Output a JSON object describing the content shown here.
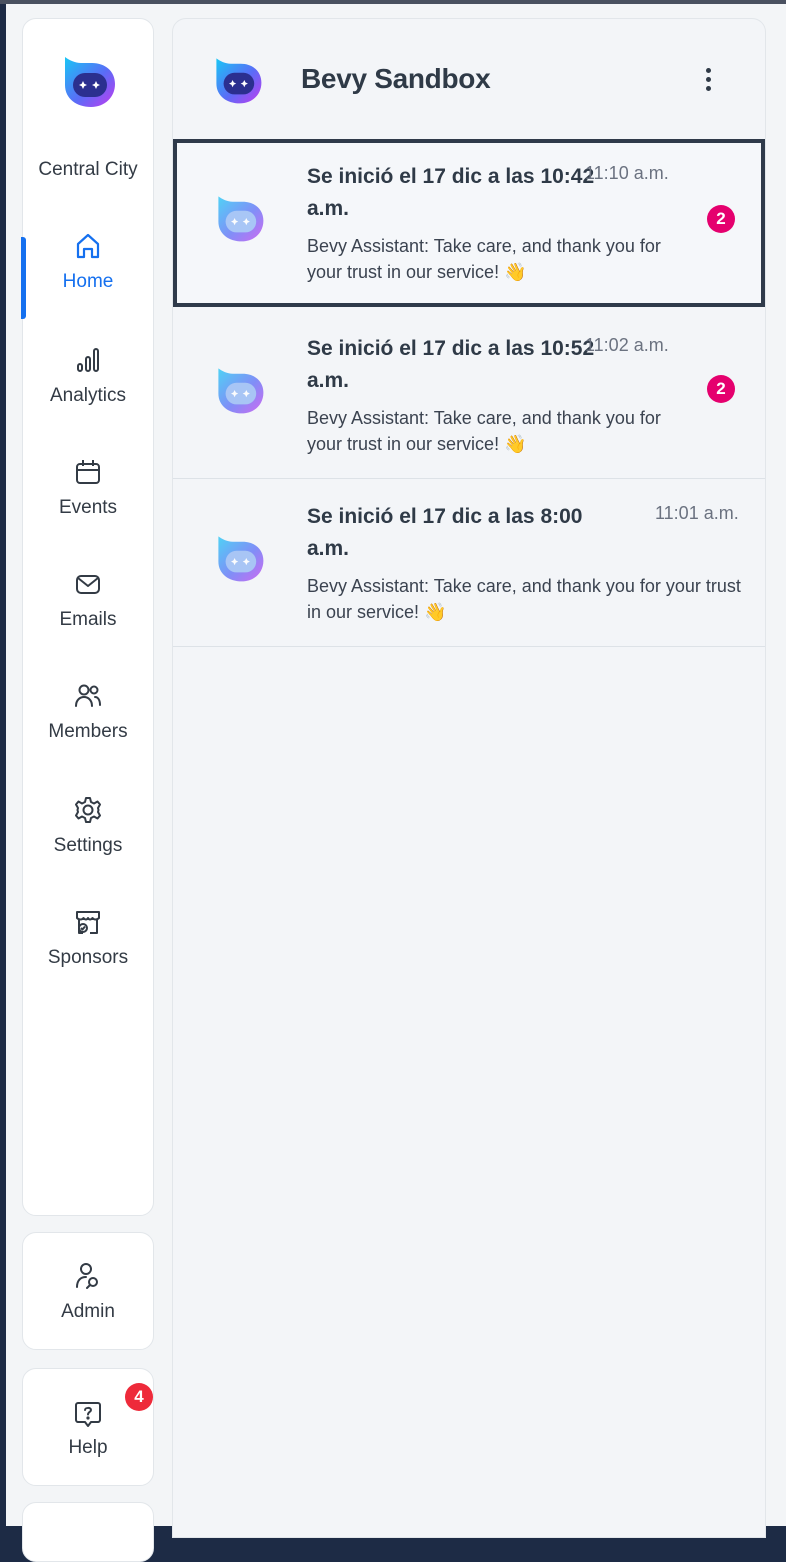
{
  "colors": {
    "accent": "#1570ef",
    "badge_pink": "#e5006e",
    "badge_red": "#ee2a3a"
  },
  "sidebar": {
    "community": "Central City",
    "items": [
      {
        "label": "Home",
        "icon": "home-icon",
        "active": true
      },
      {
        "label": "Analytics",
        "icon": "bar-chart-icon"
      },
      {
        "label": "Events",
        "icon": "calendar-icon"
      },
      {
        "label": "Emails",
        "icon": "mail-icon"
      },
      {
        "label": "Members",
        "icon": "users-icon"
      },
      {
        "label": "Settings",
        "icon": "gear-icon"
      },
      {
        "label": "Sponsors",
        "icon": "storefront-icon"
      }
    ],
    "admin": {
      "label": "Admin",
      "icon": "user-key-icon"
    },
    "help": {
      "label": "Help",
      "icon": "help-bubble-icon",
      "badge": "4"
    }
  },
  "panel": {
    "title": "Bevy Sandbox",
    "menu_icon": "more-vertical-icon",
    "conversations": [
      {
        "title": "Se inició el 17 dic a las 10:42 a.m.",
        "time": "11:10 a.m.",
        "message": "Bevy Assistant: Take care, and thank you for your trust in our service! 👋",
        "unread": "2"
      },
      {
        "title": "Se inició el 17 dic a las 10:52 a.m.",
        "time": "11:02 a.m.",
        "message": "Bevy Assistant: Take care, and thank you for your trust in our service! 👋",
        "unread": "2"
      },
      {
        "title": "Se inició el 17 dic a las 8:00 a.m.",
        "time": "11:01 a.m.",
        "message": "Bevy Assistant: Take care, and thank you for your trust in our service! 👋",
        "unread": ""
      }
    ]
  }
}
